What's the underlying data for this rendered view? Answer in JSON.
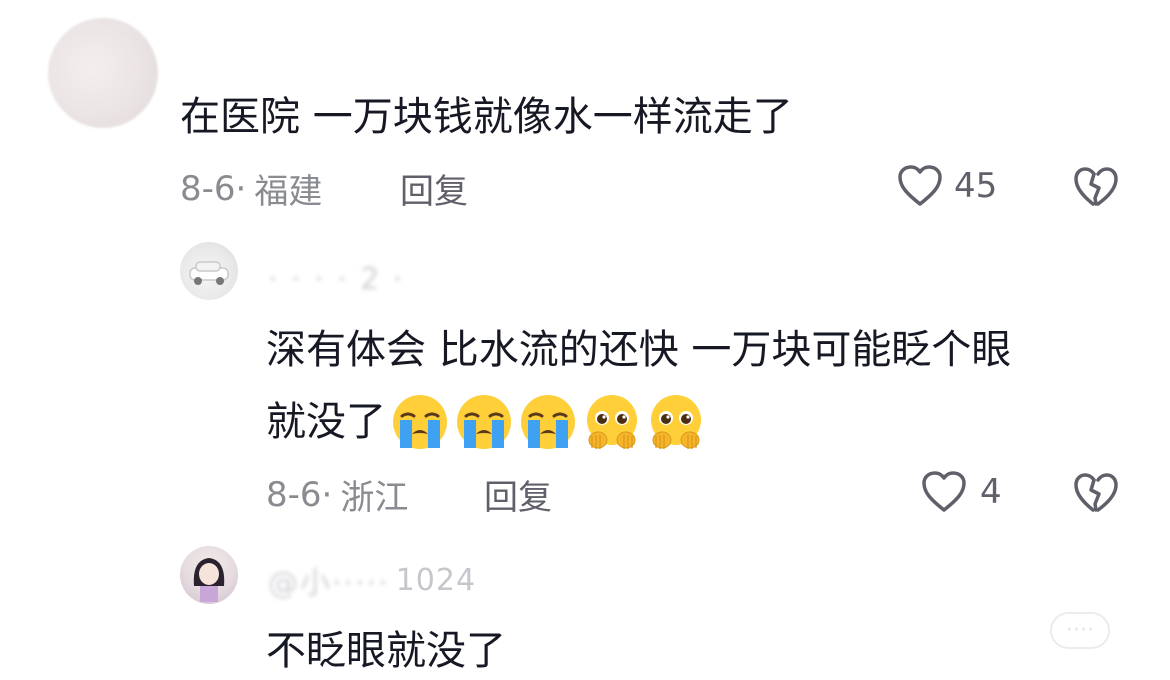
{
  "comments": [
    {
      "text": "在医院 一万块钱就像水一样流走了",
      "date": "8-6·",
      "location": "福建",
      "reply_label": "回复",
      "likes": "45"
    },
    {
      "text_line1": "深有体会 比水流的还快 一万块可能眨个眼",
      "text_line2": "就没了",
      "emojis": [
        "loudly-crying-face",
        "loudly-crying-face",
        "loudly-crying-face",
        "pleading-face-hands",
        "pleading-face-hands"
      ],
      "date": "8-6·",
      "location": "浙江",
      "reply_label": "回复",
      "likes": "4"
    },
    {
      "username_partial": "1024",
      "text": "不眨眼就没了"
    }
  ],
  "colors": {
    "text": "#161823",
    "meta": "#8a8b91",
    "icon": "#5f606a",
    "emoji_face": "#ffcf3a",
    "emoji_tears": "#3ea1f2"
  }
}
